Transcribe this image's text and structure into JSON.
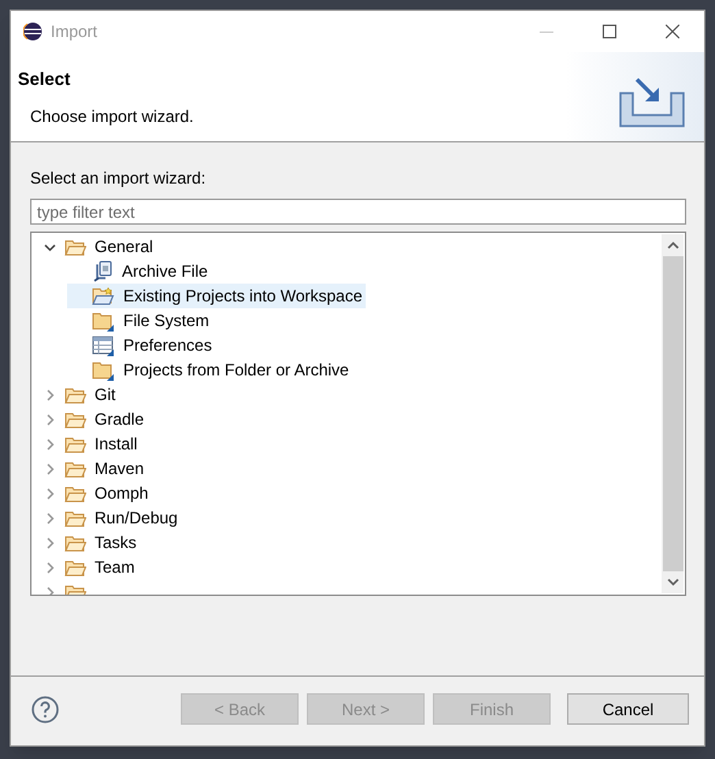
{
  "window": {
    "title": "Import"
  },
  "header": {
    "title": "Select",
    "description": "Choose import wizard."
  },
  "filter": {
    "label": "Select an import wizard:",
    "placeholder": "type filter text"
  },
  "tree": [
    {
      "label": "General",
      "kind": "folder",
      "expanded": true,
      "selected": false,
      "children": [
        {
          "label": "Archive File",
          "kind": "archive",
          "selected": false
        },
        {
          "label": "Existing Projects into Workspace",
          "kind": "project",
          "selected": true
        },
        {
          "label": "File System",
          "kind": "wizard-folder",
          "selected": false
        },
        {
          "label": "Preferences",
          "kind": "preferences",
          "selected": false
        },
        {
          "label": "Projects from Folder or Archive",
          "kind": "wizard-folder",
          "selected": false
        }
      ]
    },
    {
      "label": "Git",
      "kind": "folder",
      "expanded": false,
      "selected": false
    },
    {
      "label": "Gradle",
      "kind": "folder",
      "expanded": false,
      "selected": false
    },
    {
      "label": "Install",
      "kind": "folder",
      "expanded": false,
      "selected": false
    },
    {
      "label": "Maven",
      "kind": "folder",
      "expanded": false,
      "selected": false
    },
    {
      "label": "Oomph",
      "kind": "folder",
      "expanded": false,
      "selected": false
    },
    {
      "label": "Run/Debug",
      "kind": "folder",
      "expanded": false,
      "selected": false
    },
    {
      "label": "Tasks",
      "kind": "folder",
      "expanded": false,
      "selected": false
    },
    {
      "label": "Team",
      "kind": "folder",
      "expanded": false,
      "selected": false
    },
    {
      "kind": "folder",
      "expanded": false,
      "selected": false
    }
  ],
  "buttons": [
    {
      "label": "< Back",
      "disabled": true
    },
    {
      "label": "Next >",
      "disabled": true
    },
    {
      "label": "Finish",
      "disabled": true
    },
    {
      "label": "Cancel",
      "disabled": false
    }
  ]
}
